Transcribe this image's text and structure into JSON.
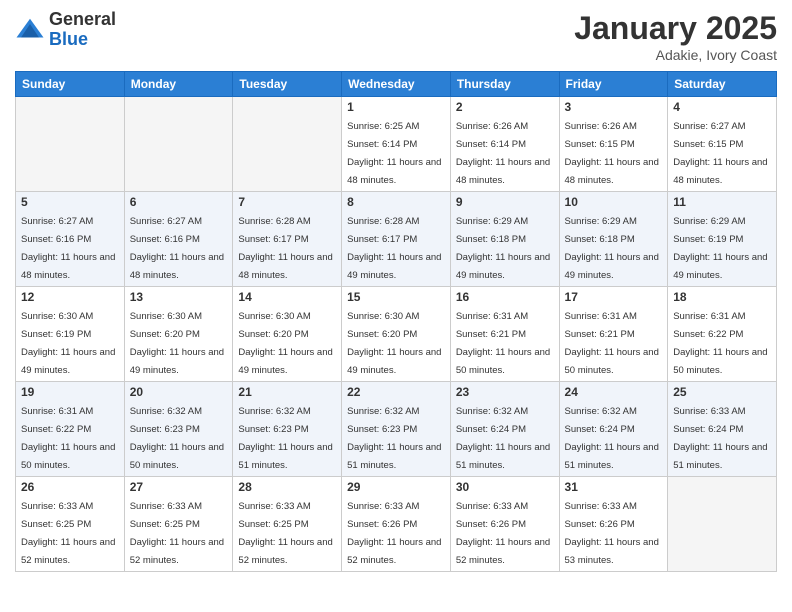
{
  "logo": {
    "general": "General",
    "blue": "Blue"
  },
  "header": {
    "title": "January 2025",
    "subtitle": "Adakie, Ivory Coast"
  },
  "weekdays": [
    "Sunday",
    "Monday",
    "Tuesday",
    "Wednesday",
    "Thursday",
    "Friday",
    "Saturday"
  ],
  "weeks": [
    [
      {
        "day": "",
        "empty": true
      },
      {
        "day": "",
        "empty": true
      },
      {
        "day": "",
        "empty": true
      },
      {
        "day": "1",
        "sunrise": "6:25 AM",
        "sunset": "6:14 PM",
        "daylight": "11 hours and 48 minutes."
      },
      {
        "day": "2",
        "sunrise": "6:26 AM",
        "sunset": "6:14 PM",
        "daylight": "11 hours and 48 minutes."
      },
      {
        "day": "3",
        "sunrise": "6:26 AM",
        "sunset": "6:15 PM",
        "daylight": "11 hours and 48 minutes."
      },
      {
        "day": "4",
        "sunrise": "6:27 AM",
        "sunset": "6:15 PM",
        "daylight": "11 hours and 48 minutes."
      }
    ],
    [
      {
        "day": "5",
        "sunrise": "6:27 AM",
        "sunset": "6:16 PM",
        "daylight": "11 hours and 48 minutes."
      },
      {
        "day": "6",
        "sunrise": "6:27 AM",
        "sunset": "6:16 PM",
        "daylight": "11 hours and 48 minutes."
      },
      {
        "day": "7",
        "sunrise": "6:28 AM",
        "sunset": "6:17 PM",
        "daylight": "11 hours and 48 minutes."
      },
      {
        "day": "8",
        "sunrise": "6:28 AM",
        "sunset": "6:17 PM",
        "daylight": "11 hours and 49 minutes."
      },
      {
        "day": "9",
        "sunrise": "6:29 AM",
        "sunset": "6:18 PM",
        "daylight": "11 hours and 49 minutes."
      },
      {
        "day": "10",
        "sunrise": "6:29 AM",
        "sunset": "6:18 PM",
        "daylight": "11 hours and 49 minutes."
      },
      {
        "day": "11",
        "sunrise": "6:29 AM",
        "sunset": "6:19 PM",
        "daylight": "11 hours and 49 minutes."
      }
    ],
    [
      {
        "day": "12",
        "sunrise": "6:30 AM",
        "sunset": "6:19 PM",
        "daylight": "11 hours and 49 minutes."
      },
      {
        "day": "13",
        "sunrise": "6:30 AM",
        "sunset": "6:20 PM",
        "daylight": "11 hours and 49 minutes."
      },
      {
        "day": "14",
        "sunrise": "6:30 AM",
        "sunset": "6:20 PM",
        "daylight": "11 hours and 49 minutes."
      },
      {
        "day": "15",
        "sunrise": "6:30 AM",
        "sunset": "6:20 PM",
        "daylight": "11 hours and 49 minutes."
      },
      {
        "day": "16",
        "sunrise": "6:31 AM",
        "sunset": "6:21 PM",
        "daylight": "11 hours and 50 minutes."
      },
      {
        "day": "17",
        "sunrise": "6:31 AM",
        "sunset": "6:21 PM",
        "daylight": "11 hours and 50 minutes."
      },
      {
        "day": "18",
        "sunrise": "6:31 AM",
        "sunset": "6:22 PM",
        "daylight": "11 hours and 50 minutes."
      }
    ],
    [
      {
        "day": "19",
        "sunrise": "6:31 AM",
        "sunset": "6:22 PM",
        "daylight": "11 hours and 50 minutes."
      },
      {
        "day": "20",
        "sunrise": "6:32 AM",
        "sunset": "6:23 PM",
        "daylight": "11 hours and 50 minutes."
      },
      {
        "day": "21",
        "sunrise": "6:32 AM",
        "sunset": "6:23 PM",
        "daylight": "11 hours and 51 minutes."
      },
      {
        "day": "22",
        "sunrise": "6:32 AM",
        "sunset": "6:23 PM",
        "daylight": "11 hours and 51 minutes."
      },
      {
        "day": "23",
        "sunrise": "6:32 AM",
        "sunset": "6:24 PM",
        "daylight": "11 hours and 51 minutes."
      },
      {
        "day": "24",
        "sunrise": "6:32 AM",
        "sunset": "6:24 PM",
        "daylight": "11 hours and 51 minutes."
      },
      {
        "day": "25",
        "sunrise": "6:33 AM",
        "sunset": "6:24 PM",
        "daylight": "11 hours and 51 minutes."
      }
    ],
    [
      {
        "day": "26",
        "sunrise": "6:33 AM",
        "sunset": "6:25 PM",
        "daylight": "11 hours and 52 minutes."
      },
      {
        "day": "27",
        "sunrise": "6:33 AM",
        "sunset": "6:25 PM",
        "daylight": "11 hours and 52 minutes."
      },
      {
        "day": "28",
        "sunrise": "6:33 AM",
        "sunset": "6:25 PM",
        "daylight": "11 hours and 52 minutes."
      },
      {
        "day": "29",
        "sunrise": "6:33 AM",
        "sunset": "6:26 PM",
        "daylight": "11 hours and 52 minutes."
      },
      {
        "day": "30",
        "sunrise": "6:33 AM",
        "sunset": "6:26 PM",
        "daylight": "11 hours and 52 minutes."
      },
      {
        "day": "31",
        "sunrise": "6:33 AM",
        "sunset": "6:26 PM",
        "daylight": "11 hours and 53 minutes."
      },
      {
        "day": "",
        "empty": true
      }
    ]
  ]
}
